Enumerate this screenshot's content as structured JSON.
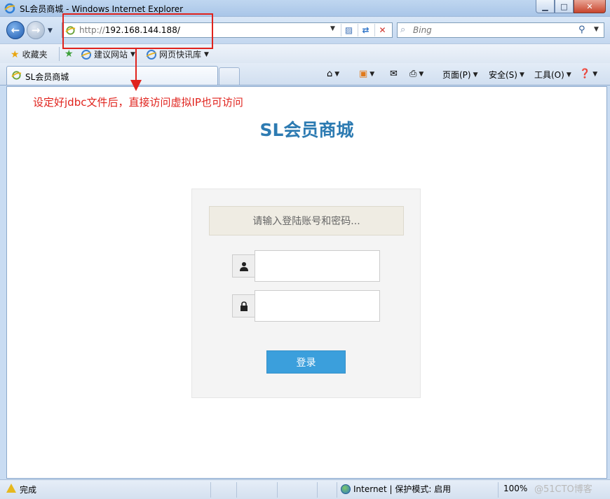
{
  "window": {
    "title": "SL会员商城 - Windows Internet Explorer",
    "min_glyph": "▁",
    "max_glyph": "□",
    "close_glyph": "✕"
  },
  "address": {
    "url_proto": "http://",
    "url_host": "192.168.144.188/",
    "search_placeholder": "Bing"
  },
  "favorites": {
    "label": "收藏夹",
    "items": [
      {
        "label": "建议网站"
      },
      {
        "label": "网页快讯库"
      }
    ]
  },
  "tab": {
    "label": "SL会员商城"
  },
  "commands": {
    "page": "页面(P)",
    "safety": "安全(S)",
    "tools": "工具(O)"
  },
  "annotation": {
    "text": "设定好jdbc文件后，直接访问虚拟IP也可访问",
    "color": "#e0231d"
  },
  "page": {
    "title": "SL会员商城",
    "notice": "请输入登陆账号和密码...",
    "login_button": "登录",
    "accent": "#3b9fdc"
  },
  "status": {
    "text": "完成",
    "zone": "Internet | 保护模式: 启用",
    "zoom": "100%",
    "watermark": "@51CTO博客"
  },
  "icons": [
    "ie-logo-icon",
    "back-icon",
    "forward-icon",
    "refresh-icon",
    "stop-icon",
    "search-icon",
    "star-icon",
    "home-icon",
    "rss-icon",
    "mail-icon",
    "print-icon",
    "help-icon",
    "user-icon",
    "lock-icon",
    "globe-icon",
    "warning-icon"
  ]
}
